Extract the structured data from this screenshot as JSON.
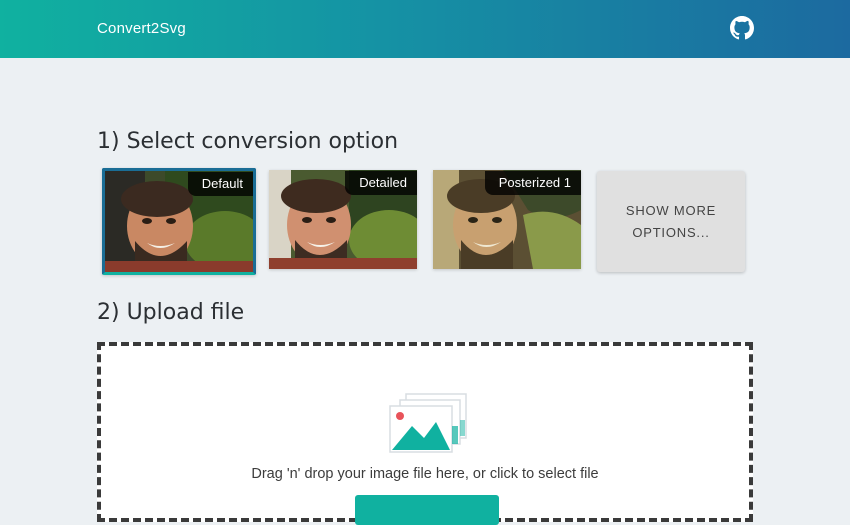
{
  "header": {
    "brand": "Convert2Svg",
    "github_icon": "github-icon"
  },
  "step1": {
    "title": "1) Select conversion option",
    "options": [
      {
        "label": "Default",
        "selected": true
      },
      {
        "label": "Detailed",
        "selected": false
      },
      {
        "label": "Posterized 1",
        "selected": false
      }
    ],
    "more_line1": "SHOW MORE",
    "more_line2": "OPTIONS..."
  },
  "step2": {
    "title": "2) Upload file",
    "drop_text": "Drag 'n' drop your image file here, or click to select file",
    "drop_icon": "image-upload-icon"
  },
  "colors": {
    "accent": "#10b1a0",
    "header_gradient_end": "#1c6aa0",
    "selected_border": "#1a6d95",
    "background": "#ecf0f3"
  }
}
